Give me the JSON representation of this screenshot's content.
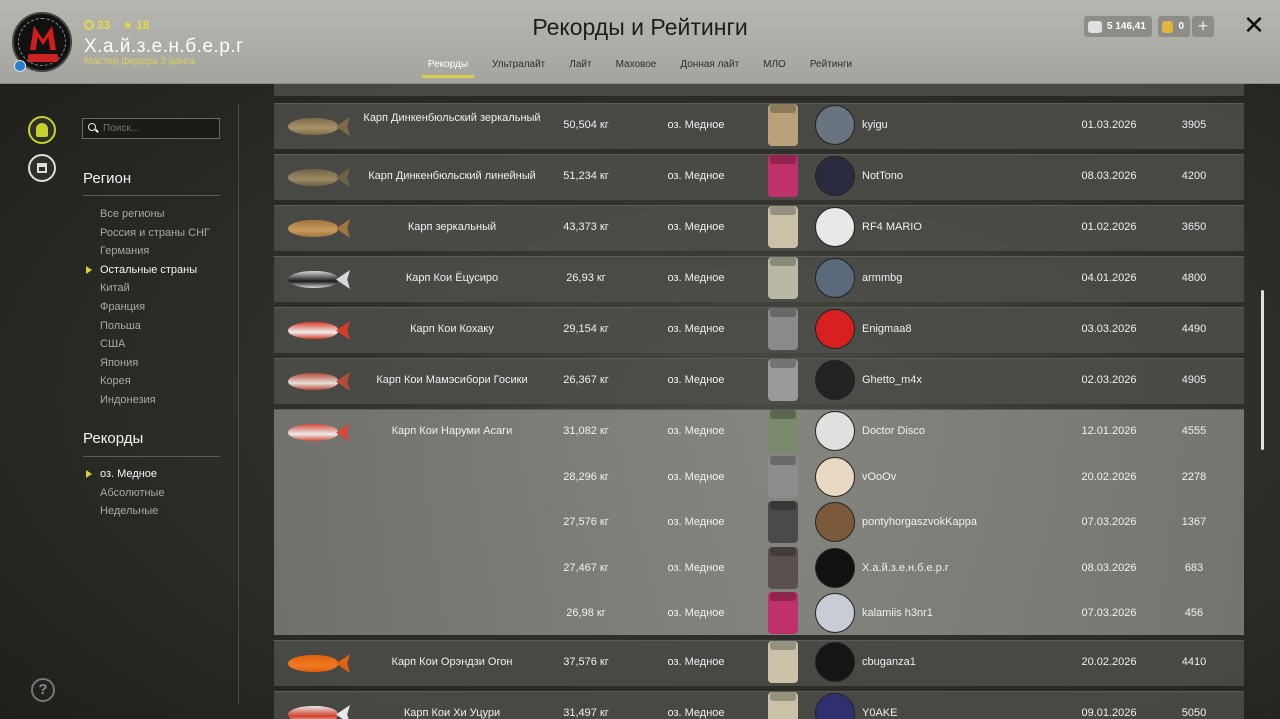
{
  "header": {
    "title": "Рекорды и Рейтинги",
    "player_name": "Х.а.й.з.е.н.б.е.р.г",
    "player_rank": "Мастер фидера 2 ранга",
    "level": "33",
    "stars": "18",
    "silver": "5 146,41",
    "gold": "0",
    "tabs": [
      "Рекорды",
      "Ультралайт",
      "Лайт",
      "Маховое",
      "Донная лайт",
      "МЛО",
      "Рейтинги"
    ],
    "active_tab": "Рекорды"
  },
  "sidebar": {
    "search_placeholder": "Поиск...",
    "region_title": "Регион",
    "regions": [
      "Все регионы",
      "Россия и страны СНГ",
      "Германия",
      "Остальные страны",
      "Китай",
      "Франция",
      "Польша",
      "США",
      "Япония",
      "Корея",
      "Индонезия"
    ],
    "active_region": "Остальные страны",
    "records_title": "Рекорды",
    "records": [
      "оз. Медное",
      "Абсолютные",
      "Недельные"
    ],
    "active_record": "оз. Медное"
  },
  "rows": [
    {
      "fish": "Карп Динкенбюльский зеркальный",
      "weight": "50,504 кг",
      "lake": "оз. Медное",
      "player": "kyigu",
      "date": "01.03.2026",
      "score": "3905"
    },
    {
      "fish": "Карп Динкенбюльский линейный",
      "weight": "51,234 кг",
      "lake": "оз. Медное",
      "player": "NotTono",
      "date": "08.03.2026",
      "score": "4200"
    },
    {
      "fish": "Карп зеркальный",
      "weight": "43,373 кг",
      "lake": "оз. Медное",
      "player": "RF4 MARIO",
      "date": "01.02.2026",
      "score": "3650"
    },
    {
      "fish": "Карп Кои Ёцусиро",
      "weight": "26,93 кг",
      "lake": "оз. Медное",
      "player": "armmbg",
      "date": "04.01.2026",
      "score": "4800"
    },
    {
      "fish": "Карп Кои Кохаку",
      "weight": "29,154 кг",
      "lake": "оз. Медное",
      "player": "Enigmaa8",
      "date": "03.03.2026",
      "score": "4490"
    },
    {
      "fish": "Карп Кои Мамэсибори Госики",
      "weight": "26,367 кг",
      "lake": "оз. Медное",
      "player": "Ghetto_m4x",
      "date": "02.03.2026",
      "score": "4905"
    }
  ],
  "expanded": {
    "fish": "Карп Кои Наруми Асаги",
    "entries": [
      {
        "weight": "31,082 кг",
        "lake": "оз. Медное",
        "player": "Doctor Disco",
        "date": "12.01.2026",
        "score": "4555"
      },
      {
        "weight": "28,296 кг",
        "lake": "оз. Медное",
        "player": "vOoOv",
        "date": "20.02.2026",
        "score": "2278"
      },
      {
        "weight": "27,576 кг",
        "lake": "оз. Медное",
        "player": "pontyhorgaszvokKappa",
        "date": "07.03.2026",
        "score": "1367"
      },
      {
        "weight": "27,467 кг",
        "lake": "оз. Медное",
        "player": "Х.а.й.з.е.н.б.е.р.г",
        "date": "08.03.2026",
        "score": "683"
      },
      {
        "weight": "26,98 кг",
        "lake": "оз. Медное",
        "player": "kalamiis h3nr1",
        "date": "07.03.2026",
        "score": "456"
      }
    ]
  },
  "rows_after": [
    {
      "fish": "Карп Кои Орэндзи Огон",
      "weight": "37,576 кг",
      "lake": "оз. Медное",
      "player": "cbuganza1",
      "date": "20.02.2026",
      "score": "4410"
    },
    {
      "fish": "Карп Кои Хи Уцури",
      "weight": "31,497 кг",
      "lake": "оз. Медное",
      "player": "Y0AKE",
      "date": "09.01.2026",
      "score": "5050"
    }
  ],
  "colors": {
    "accent": "#d9d04a",
    "header_bg": "#b0b0aa"
  }
}
